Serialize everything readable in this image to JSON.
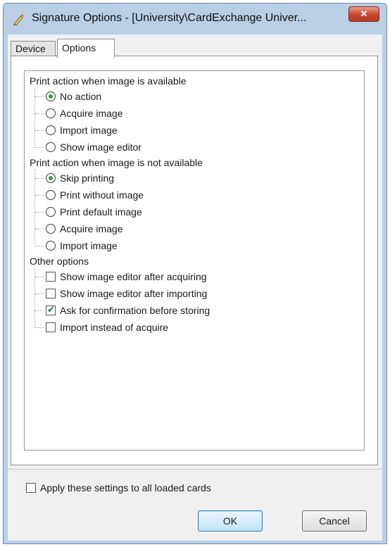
{
  "window": {
    "title": "Signature Options - [University\\CardExchange Univer...",
    "close_label": "✕"
  },
  "tabs": [
    {
      "label": "Device",
      "selected": false
    },
    {
      "label": "Options",
      "selected": true
    }
  ],
  "groups": [
    {
      "title": "Print action when image is available",
      "type": "radio",
      "items": [
        {
          "label": "No action",
          "selected": true
        },
        {
          "label": "Acquire image",
          "selected": false
        },
        {
          "label": "Import image",
          "selected": false
        },
        {
          "label": "Show image editor",
          "selected": false
        }
      ]
    },
    {
      "title": "Print action when image is not available",
      "type": "radio",
      "items": [
        {
          "label": "Skip printing",
          "selected": true
        },
        {
          "label": "Print without image",
          "selected": false
        },
        {
          "label": "Print default image",
          "selected": false
        },
        {
          "label": "Acquire image",
          "selected": false
        },
        {
          "label": "Import image",
          "selected": false
        }
      ]
    },
    {
      "title": "Other options",
      "type": "checkbox",
      "items": [
        {
          "label": "Show image editor after acquiring",
          "checked": false
        },
        {
          "label": "Show image editor after importing",
          "checked": false
        },
        {
          "label": "Ask for confirmation before storing",
          "checked": true
        },
        {
          "label": "Import instead of acquire",
          "checked": false
        }
      ]
    }
  ],
  "apply_all": {
    "label": "Apply these settings to all loaded cards",
    "checked": false
  },
  "buttons": {
    "ok": "OK",
    "cancel": "Cancel"
  }
}
